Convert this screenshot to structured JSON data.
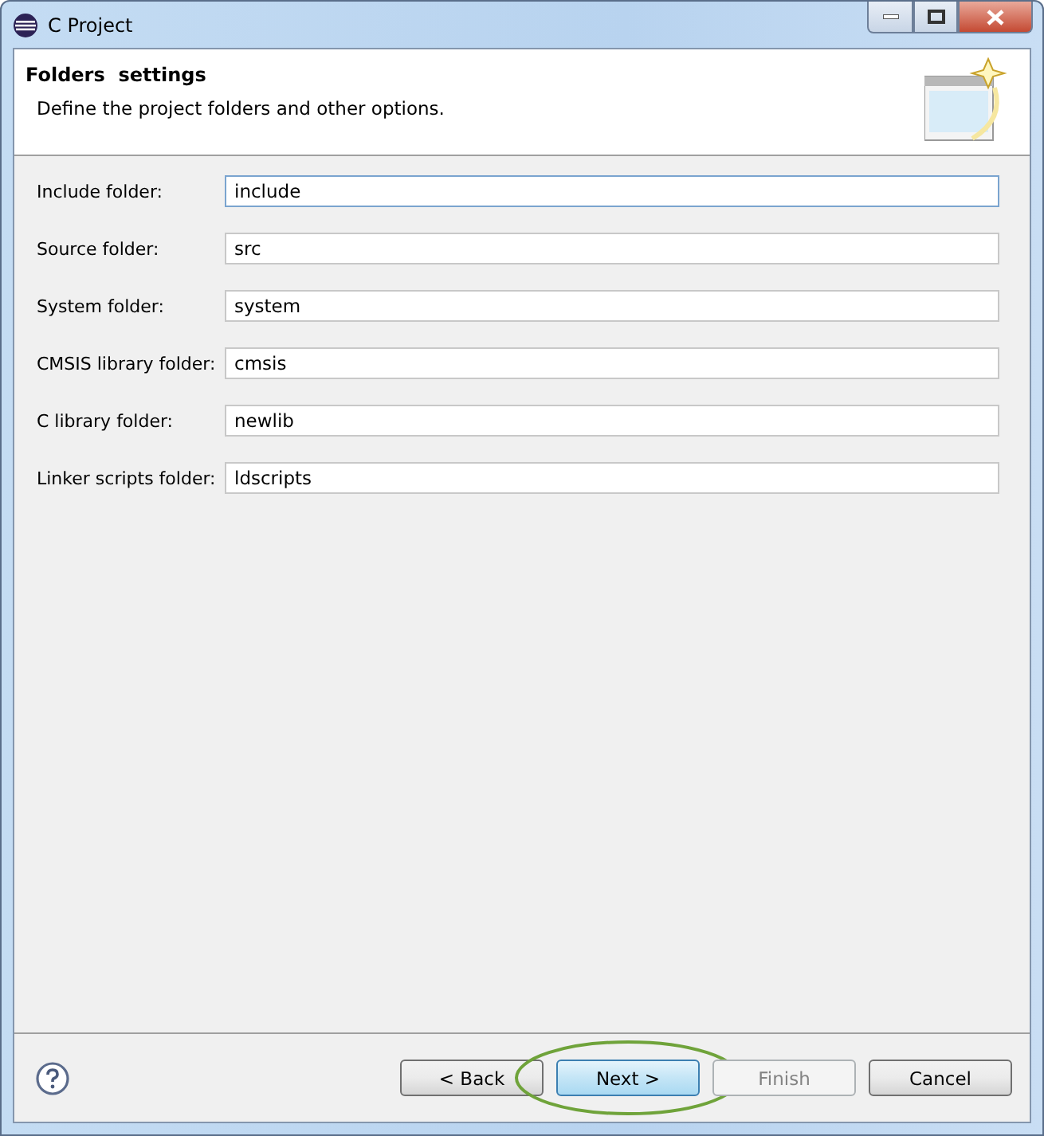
{
  "window": {
    "title": "C Project"
  },
  "header": {
    "title": "Folders  settings",
    "description": "Define the project folders and other options."
  },
  "fields": [
    {
      "label": "Include folder:",
      "value": "include",
      "focused": true
    },
    {
      "label": "Source folder:",
      "value": "src",
      "focused": false
    },
    {
      "label": "System folder:",
      "value": "system",
      "focused": false
    },
    {
      "label": "CMSIS library folder:",
      "value": "cmsis",
      "focused": false
    },
    {
      "label": "C library folder:",
      "value": "newlib",
      "focused": false
    },
    {
      "label": "Linker scripts folder:",
      "value": "ldscripts",
      "focused": false
    }
  ],
  "buttons": [
    {
      "label": "< Back",
      "disabled": false,
      "default": false,
      "circled": false
    },
    {
      "label": "Next >",
      "disabled": false,
      "default": true,
      "circled": true
    },
    {
      "label": "Finish",
      "disabled": true,
      "default": false,
      "circled": false
    },
    {
      "label": "Cancel",
      "disabled": false,
      "default": false,
      "circled": false
    }
  ]
}
